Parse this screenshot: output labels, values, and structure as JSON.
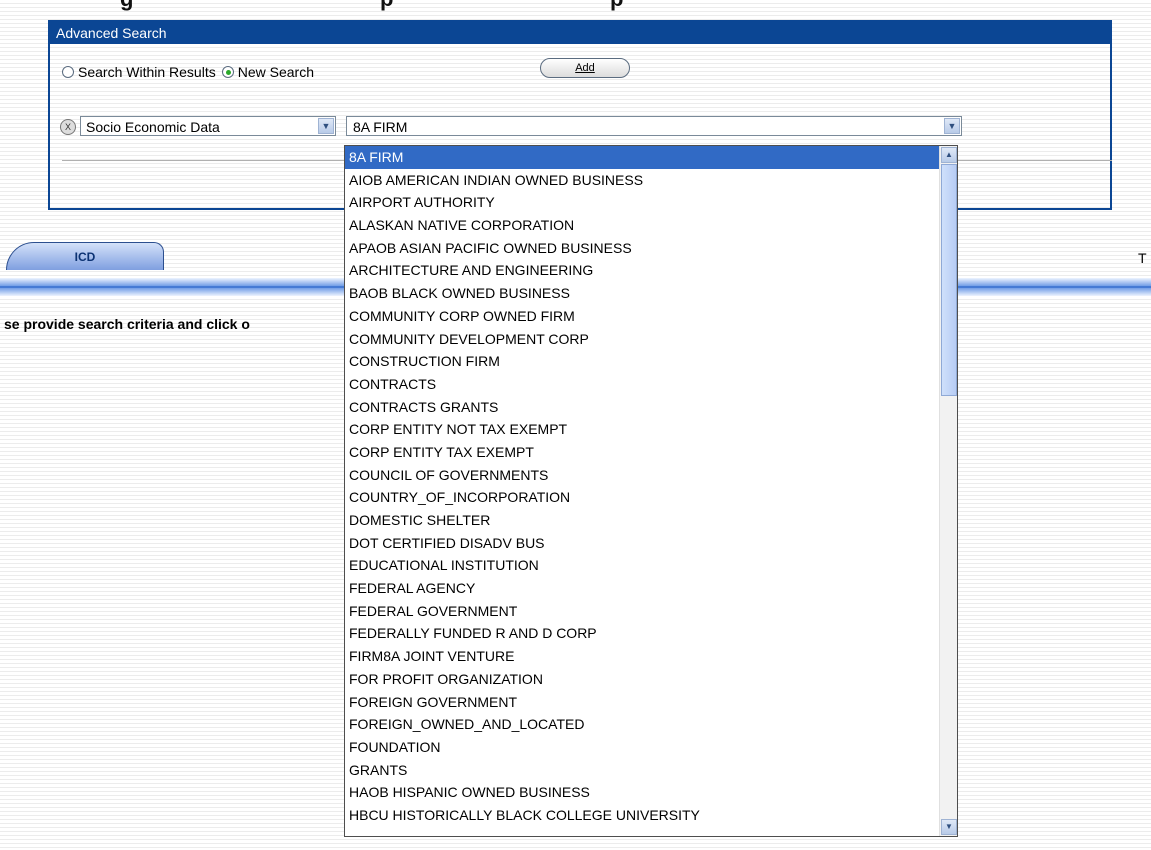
{
  "advanced_search": {
    "title": "Advanced Search",
    "radio_within_label": "Search Within Results",
    "radio_new_label": "New Search",
    "add_label": "Add",
    "field_select_value": "Socio Economic Data",
    "value_select_value": "8A FIRM",
    "remove_icon": "close-icon",
    "dropdown_icon": "chevron-down-icon"
  },
  "tab": {
    "label": "ICD"
  },
  "truncated_text": {
    "right": "T",
    "message": "se provide search criteria and click o"
  },
  "dropdown_options": [
    "8A FIRM",
    "AIOB AMERICAN INDIAN OWNED BUSINESS",
    "AIRPORT AUTHORITY",
    "ALASKAN NATIVE CORPORATION",
    "APAOB ASIAN PACIFIC OWNED BUSINESS",
    "ARCHITECTURE AND ENGINEERING",
    "BAOB BLACK OWNED BUSINESS",
    "COMMUNITY CORP OWNED FIRM",
    "COMMUNITY DEVELOPMENT CORP",
    "CONSTRUCTION FIRM",
    "CONTRACTS",
    "CONTRACTS GRANTS",
    "CORP ENTITY NOT TAX EXEMPT",
    "CORP ENTITY TAX EXEMPT",
    "COUNCIL OF GOVERNMENTS",
    "COUNTRY_OF_INCORPORATION",
    "DOMESTIC SHELTER",
    "DOT CERTIFIED DISADV BUS",
    "EDUCATIONAL INSTITUTION",
    "FEDERAL AGENCY",
    "FEDERAL GOVERNMENT",
    "FEDERALLY FUNDED R AND D CORP",
    "FIRM8A JOINT VENTURE",
    "FOR PROFIT ORGANIZATION",
    "FOREIGN GOVERNMENT",
    "FOREIGN_OWNED_AND_LOCATED",
    "FOUNDATION",
    "GRANTS",
    "HAOB HISPANIC OWNED BUSINESS",
    "HBCU HISTORICALLY BLACK COLLEGE UNIVERSITY"
  ],
  "colors": {
    "header": "#0b4694",
    "selected_option": "#316ac5"
  }
}
